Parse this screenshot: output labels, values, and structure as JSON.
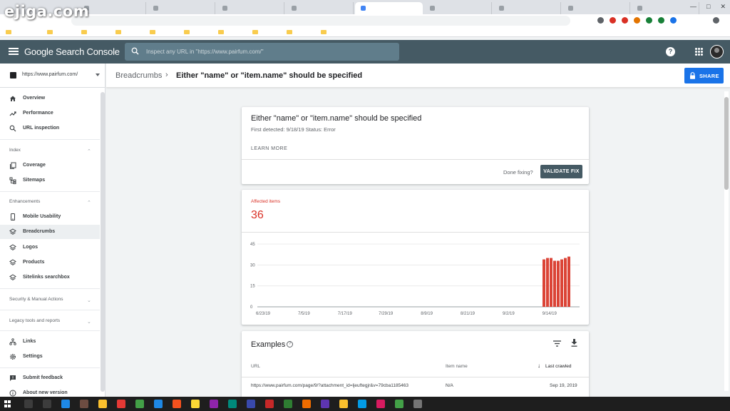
{
  "watermark": "ejiga.com",
  "browser": {
    "tabs": [
      "",
      "",
      "",
      "",
      "",
      "",
      "",
      "",
      "",
      ""
    ],
    "omnibox": ""
  },
  "header": {
    "brand": "Google Search Console",
    "search_placeholder": "Inspect any URL in \"https://www.pairfum.com/\"",
    "help": "?"
  },
  "sidebar": {
    "property": "https://www.pairfum.com/",
    "top_items": [
      {
        "label": "Overview",
        "icon": "home-icon"
      },
      {
        "label": "Performance",
        "icon": "trending-up-icon"
      },
      {
        "label": "URL inspection",
        "icon": "search-icon"
      }
    ],
    "index": {
      "heading": "Index",
      "items": [
        {
          "label": "Coverage",
          "icon": "file-copy-icon"
        },
        {
          "label": "Sitemaps",
          "icon": "sitemap-icon"
        }
      ]
    },
    "enhancements": {
      "heading": "Enhancements",
      "items": [
        {
          "label": "Mobile Usability",
          "icon": "phone-icon"
        },
        {
          "label": "Breadcrumbs",
          "icon": "layers-icon"
        },
        {
          "label": "Logos",
          "icon": "layers-icon"
        },
        {
          "label": "Products",
          "icon": "layers-icon"
        },
        {
          "label": "Sitelinks searchbox",
          "icon": "layers-icon"
        }
      ]
    },
    "security_heading": "Security & Manual Actions",
    "legacy_heading": "Legacy tools and reports",
    "bottom_items": [
      {
        "label": "Links",
        "icon": "links-icon"
      },
      {
        "label": "Settings",
        "icon": "gear-icon"
      },
      {
        "label": "Submit feedback",
        "icon": "feedback-icon"
      },
      {
        "label": "About new version",
        "icon": "info-icon"
      }
    ]
  },
  "pagebar": {
    "crumb_parent": "Breadcrumbs",
    "crumb_sep": "›",
    "crumb_current": "Either \"name\" or \"item.name\" should be specified",
    "share_label": "SHARE"
  },
  "issue": {
    "title": "Either \"name\" or \"item.name\" should be specified",
    "meta": "First detected: 9/18/19    Status: Error",
    "learn_more": "LEARN MORE",
    "done_fixing": "Done fixing?",
    "validate_label": "VALIDATE FIX"
  },
  "affected": {
    "label": "Affected items",
    "value": "36"
  },
  "chart_data": {
    "type": "bar",
    "title": "",
    "xlabel": "",
    "ylabel": "",
    "ylim": [
      0,
      45
    ],
    "yticks": [
      0,
      15,
      30,
      45
    ],
    "xticks": [
      "6/23/19",
      "7/5/19",
      "7/17/19",
      "7/29/19",
      "8/9/19",
      "8/21/19",
      "9/2/19",
      "9/14/19"
    ],
    "x": [
      "9/12/19",
      "9/13/19",
      "9/14/19",
      "9/15/19",
      "9/16/19",
      "9/17/19",
      "9/18/19",
      "9/19/19"
    ],
    "values": [
      34,
      35,
      35,
      33,
      33,
      34,
      35,
      36
    ],
    "color": "#db4437",
    "grid": true
  },
  "examples": {
    "title": "Examples",
    "col_url": "URL",
    "col_item": "Item name",
    "col_last": "Last crawled",
    "rows": [
      {
        "url": "https://www.pairfum.com/page/9/?attachment_id=ljeuftegjr&v=79cba1185463",
        "item": "N/A",
        "date": "Sep 19, 2019"
      }
    ]
  },
  "taskbar": {
    "clock": ""
  }
}
